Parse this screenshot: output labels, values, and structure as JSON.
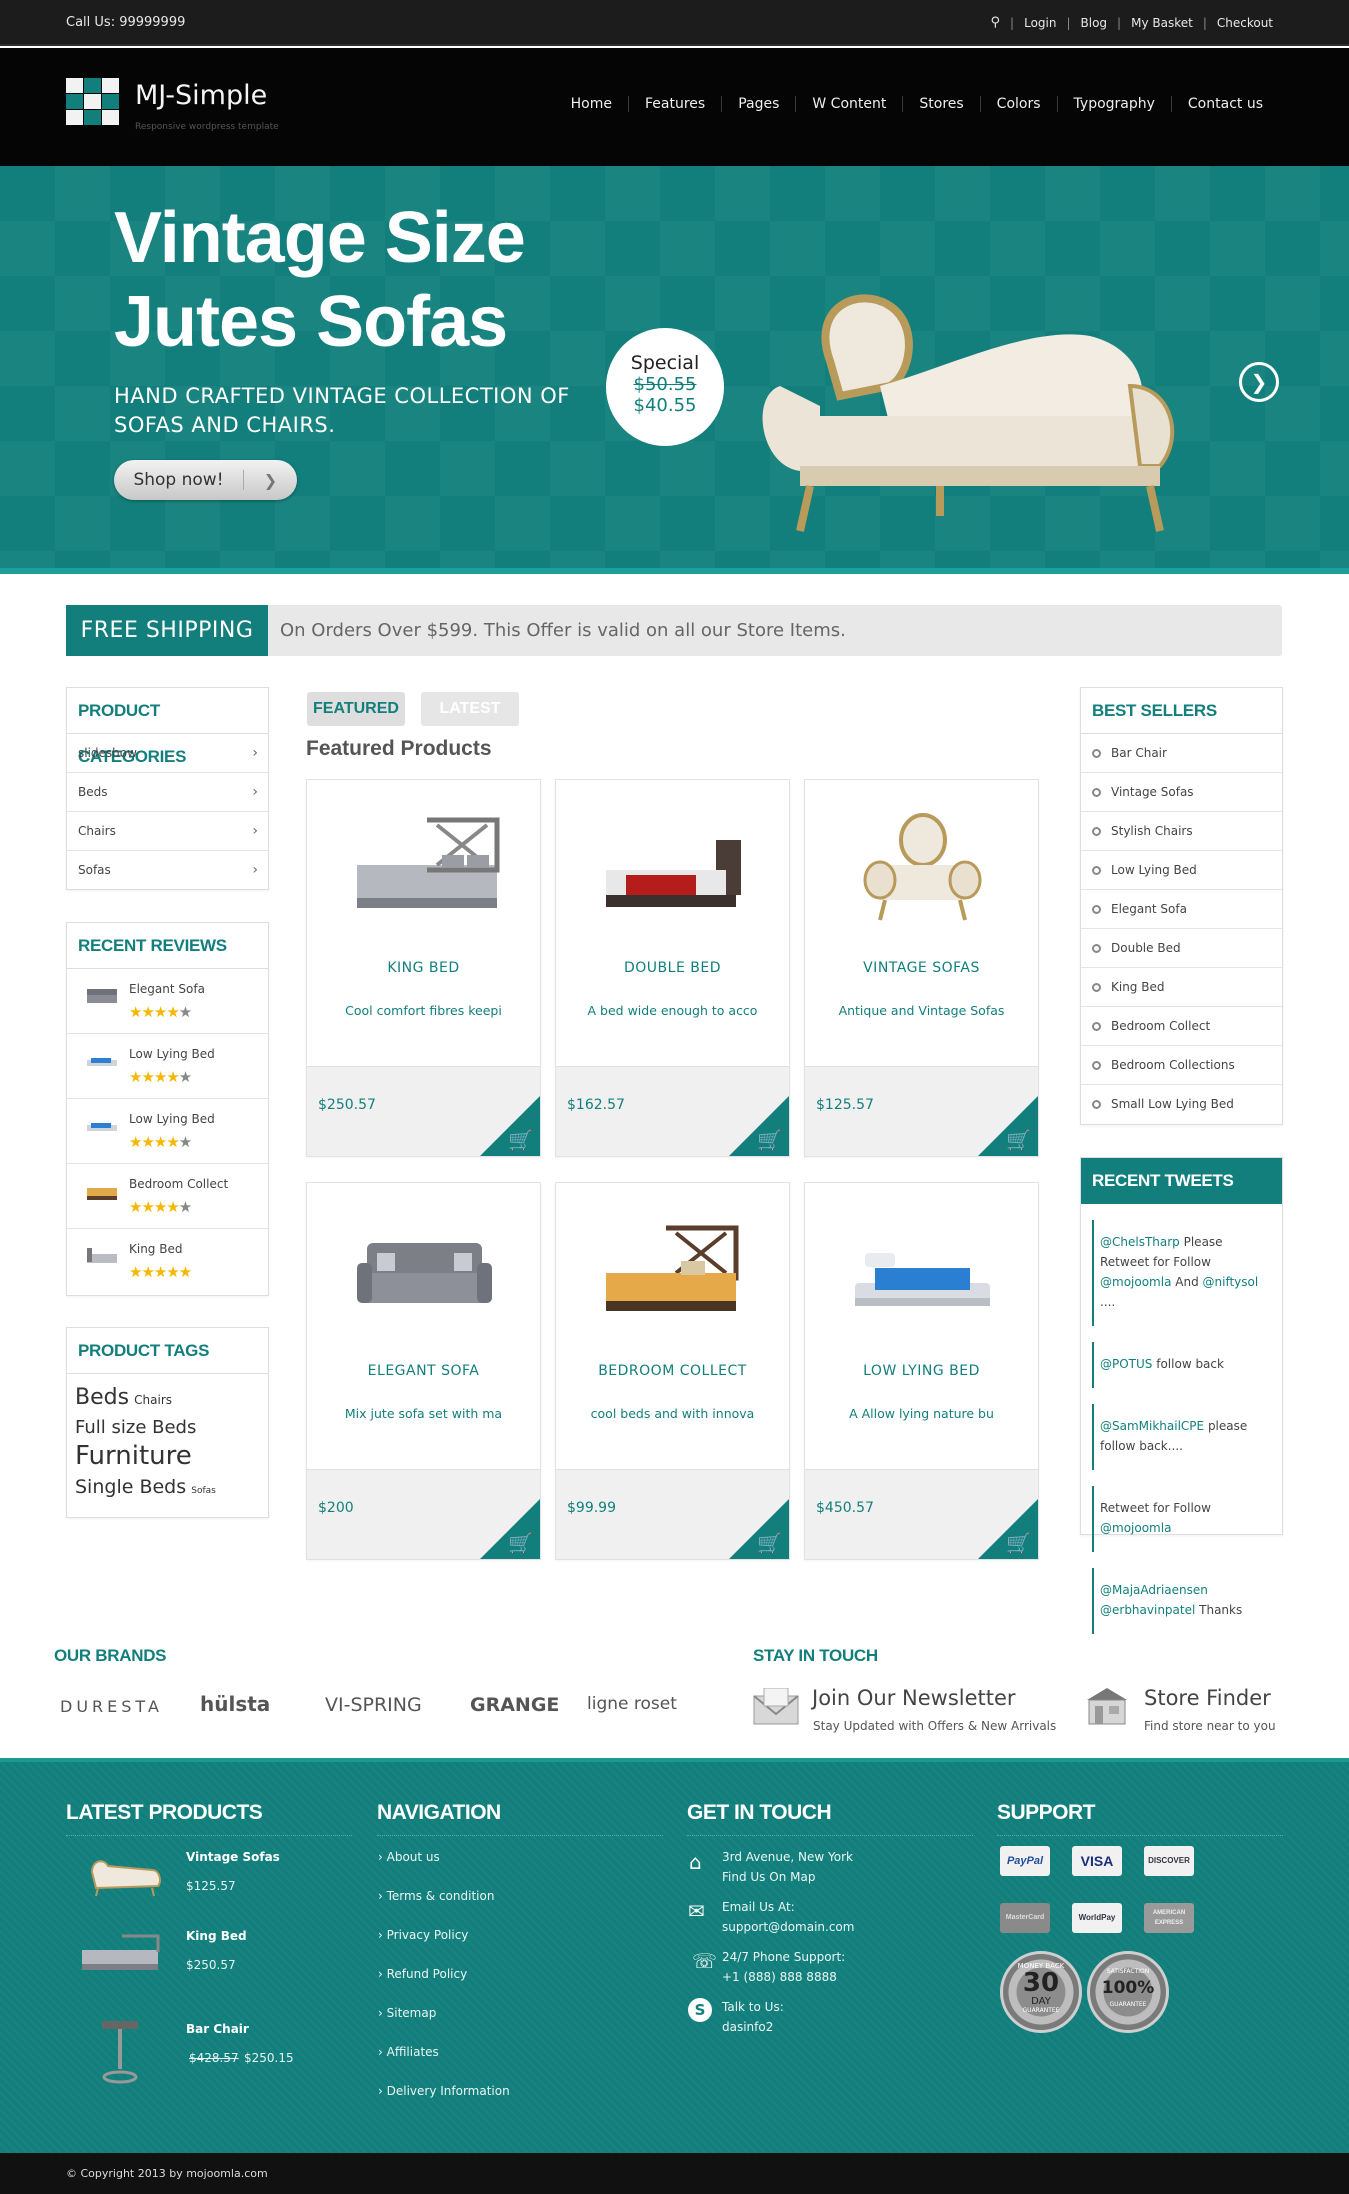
{
  "topbar": {
    "call": "Call Us: 99999999",
    "links": [
      "Login",
      "Blog",
      "My Basket",
      "Checkout"
    ]
  },
  "header": {
    "logo_title": "MJ-Simple",
    "logo_sub": "Responsive wordpress template",
    "nav": [
      "Home",
      "Features",
      "Pages",
      "W Content",
      "Stores",
      "Colors",
      "Typography",
      "Contact us"
    ]
  },
  "hero": {
    "title_line1": "Vintage Size",
    "title_line2": "Jutes Sofas",
    "subtitle": "HAND CRAFTED VINTAGE COLLECTION OF SOFAS AND CHAIRS.",
    "button": "Shop now!",
    "special_label": "Special",
    "old_price": "$50.55",
    "new_price": "$40.55"
  },
  "shipping": {
    "label": "FREE SHIPPING",
    "text": "On Orders Over $599. This Offer is valid on all our Store Items."
  },
  "categories": {
    "title": "PRODUCT CATEGORIES",
    "items": [
      "slideshow",
      "Beds",
      "Chairs",
      "Sofas"
    ]
  },
  "reviews": {
    "title": "RECENT REVIEWS",
    "items": [
      {
        "name": "Elegant Sofa",
        "stars": 4
      },
      {
        "name": "Low Lying Bed",
        "stars": 4
      },
      {
        "name": "Low Lying Bed",
        "stars": 4
      },
      {
        "name": "Bedroom Collect",
        "stars": 4
      },
      {
        "name": "King Bed",
        "stars": 5
      }
    ]
  },
  "tags": {
    "title": "PRODUCT TAGS",
    "items": [
      "Beds",
      "Chairs",
      "Full size Beds",
      "Furniture",
      "Single Beds",
      "Sofas"
    ]
  },
  "tabs": {
    "featured": "FEATURED",
    "latest": "LATEST",
    "heading": "Featured Products"
  },
  "products": [
    {
      "name": "KING BED",
      "desc": "Cool comfort fibres keepi",
      "price": "$250.57"
    },
    {
      "name": "DOUBLE BED",
      "desc": "A bed wide enough to acco",
      "price": "$162.57"
    },
    {
      "name": "VINTAGE SOFAS",
      "desc": "Antique and Vintage Sofas",
      "price": "$125.57"
    },
    {
      "name": "ELEGANT SOFA",
      "desc": "Mix jute sofa set with ma",
      "price": "$200"
    },
    {
      "name": "BEDROOM COLLECT",
      "desc": "cool beds and with innova",
      "price": "$99.99"
    },
    {
      "name": "LOW LYING BED",
      "desc": "A  Allow lying nature bu",
      "price": "$450.57"
    }
  ],
  "best_sellers": {
    "title": "BEST SELLERS",
    "items": [
      "Bar Chair",
      "Vintage Sofas",
      "Stylish Chairs",
      "Low Lying Bed",
      "Elegant Sofa",
      "Double Bed",
      "King Bed",
      "Bedroom Collect",
      "Bedroom Collections",
      "Small Low Lying Bed"
    ]
  },
  "tweets": {
    "title": "RECENT TWEETS",
    "t1": {
      "h1": "@ChelsTharp",
      "a": " Please Retweet for Follow ",
      "h2": "@mojoomla",
      "b": " And ",
      "h3": "@niftysol",
      "c": " ...."
    },
    "t2": {
      "h1": "@POTUS",
      "a": " follow back"
    },
    "t3": {
      "h1": "@SamMikhailCPE",
      "a": " please follow back...."
    },
    "t4": {
      "a": "Retweet for Follow ",
      "h1": "@mojoomla"
    },
    "t5": {
      "h1": "@MajaAdriaensen",
      "h2": "@erbhavinpatel",
      "a": " Thanks"
    }
  },
  "brands": {
    "title": "OUR BRANDS",
    "items": [
      "DURESTA",
      "hülsta",
      "VI-SPRING",
      "GRANGE",
      "ligne roset"
    ]
  },
  "stay": {
    "title": "STAY IN TOUCH",
    "newsletter_title": "Join Our Newsletter",
    "newsletter_sub": "Stay Updated with Offers & New Arrivals",
    "finder_title": "Store Finder",
    "finder_sub": "Find store near to you"
  },
  "footer": {
    "latest_title": "LATEST PRODUCTS",
    "latest": [
      {
        "name": "Vintage Sofas",
        "price": "$125.57",
        "old": ""
      },
      {
        "name": "King Bed",
        "price": "$250.57",
        "old": ""
      },
      {
        "name": "Bar Chair",
        "price": "$250.15",
        "old": "$428.57"
      }
    ],
    "nav_title": "NAVIGATION",
    "nav": [
      "About us",
      "Terms & condition",
      "Privacy Policy",
      "Refund Policy",
      "Sitemap",
      "Affiliates",
      "Delivery Information"
    ],
    "touch_title": "GET IN TOUCH",
    "address": [
      "3rd Avenue, New York",
      "Find Us On Map"
    ],
    "email": [
      "Email Us At:",
      "support@domain.com"
    ],
    "phone": [
      "24/7 Phone Support:",
      "+1 (888) 888 8888"
    ],
    "skype": [
      "Talk to Us:",
      "dasinfo2"
    ],
    "support_title": "SUPPORT",
    "payments": [
      "PayPal",
      "VISA",
      "DISCOVER",
      "MasterCard",
      "WorldPay",
      "AMERICAN EXPRESS"
    ],
    "seal1": [
      "MONEY BACK",
      "30",
      "DAY",
      "GUARANTEE"
    ],
    "seal2": [
      "SATISFACTION",
      "100%",
      "GUARANTEE"
    ]
  },
  "copyright": "© Copyright 2013 by mojoomla.com"
}
